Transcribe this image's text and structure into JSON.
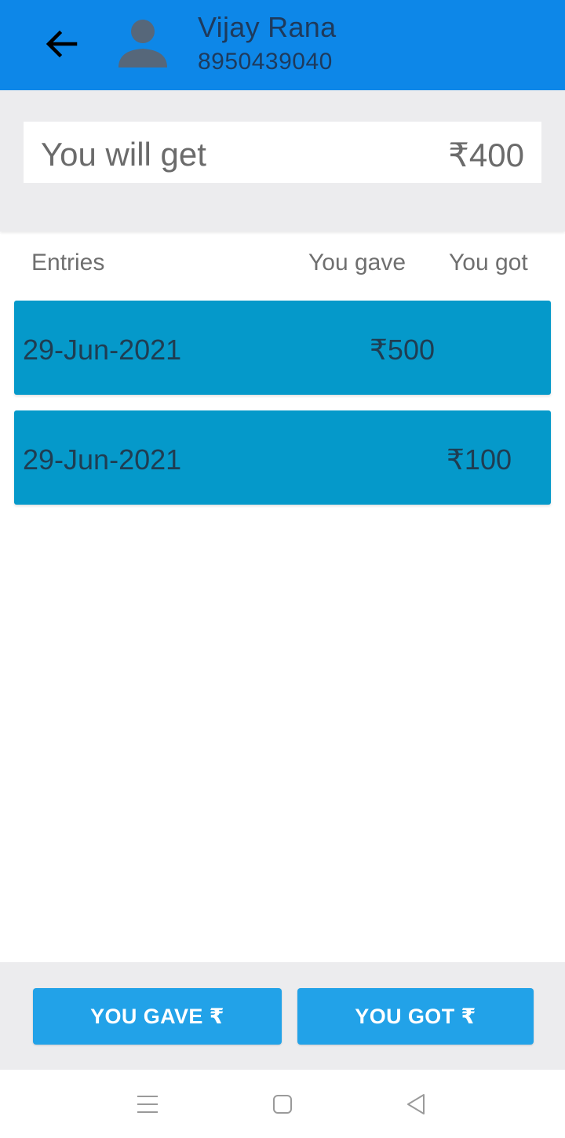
{
  "header": {
    "contact_name": "Vijay Rana",
    "contact_phone": "8950439040",
    "back_icon": "arrow-left-icon",
    "avatar_icon": "person-icon"
  },
  "summary": {
    "label": "You will get",
    "amount": "₹400"
  },
  "table": {
    "columns": [
      "Entries",
      "You gave",
      "You got"
    ],
    "rows": [
      {
        "date": "29-Jun-2021",
        "you_gave": "₹500",
        "you_got": ""
      },
      {
        "date": "29-Jun-2021",
        "you_gave": "",
        "you_got": "₹100"
      }
    ]
  },
  "actions": {
    "gave_label": "YOU GAVE ₹",
    "got_label": "YOU GOT ₹"
  },
  "system_nav": {
    "menu_icon": "menu-icon",
    "home_icon": "home-icon",
    "back_icon": "back-triangle-icon"
  },
  "colors": {
    "appbar": "#0d87e8",
    "row": "#0599ca",
    "button": "#22a2e8",
    "band": "#ececee"
  }
}
